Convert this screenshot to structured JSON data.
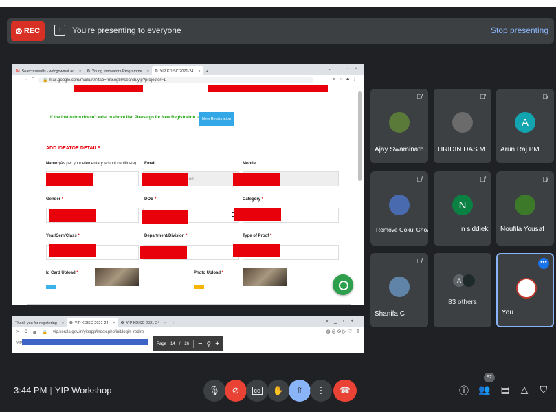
{
  "topbar": {
    "rec_label": "REC",
    "presenting_text": "You're presenting to everyone",
    "stop_label": "Stop presenting"
  },
  "browser1": {
    "tabs": [
      {
        "label": "Search results - wdcgowmat.ac"
      },
      {
        "label": "Young Innovators Programme"
      },
      {
        "label": "YIP KDISC 2021-24"
      }
    ],
    "new_tab": "+",
    "url": "mail.google.com/mail/u/0/?tab=rm&ogbl#search/yip?projector=1",
    "reg_note": "If the Institution doesn't exist in above list, Please go for New Registration -->",
    "reg_button": "New Registration",
    "section_title": "ADD IDEATOR DETAILS",
    "fields": {
      "name_label": "Name",
      "name_hint": "(As per your elementary school certificate)",
      "email_label": "Email",
      "email_tail": "om",
      "mobile_label": "Mobile",
      "gender_label": "Gender",
      "dob_label": "DOB",
      "category_label": "Category",
      "year_label": "Year/Sem/Class",
      "department_label": "Department/Division",
      "proof_label": "Type of Proof",
      "idcard_label": "Id Card Upload",
      "photo_label": "Photo Upload"
    }
  },
  "browser2": {
    "tabs": [
      {
        "label": "Thank you for registering"
      },
      {
        "label": "YIP KDISC 2021-24"
      },
      {
        "label": "YIP KDISC 2021-24"
      }
    ],
    "url": "yip.kerala.gov.in/yipapp/index.php/init/login_redire",
    "page_label": "Page",
    "page_current": "14",
    "page_sep": "/",
    "page_total": "26",
    "zoom_out": "−",
    "zoom_in": "+",
    "yip_prefix": "YIP K"
  },
  "participants": [
    {
      "name": "Ajay Swaminath...",
      "avatar_color": "#5a7a3a"
    },
    {
      "name": "HRIDIN DAS M",
      "avatar_color": "#6b6b6b"
    },
    {
      "name": "Arun Raj PM",
      "letter": "A",
      "avatar_color": "#12a4af"
    },
    {
      "name": "Remove Gokul Chowallur from the call",
      "avatar_color": "#4a6ab0"
    },
    {
      "name": "n siddiek",
      "letter": "N",
      "avatar_color": "#0b8043"
    },
    {
      "name": "Noufila Yousaf",
      "avatar_color": "#3c7a2a"
    },
    {
      "name": "Shanifa C",
      "avatar_color": "#5f84a8"
    },
    {
      "name": "83 others",
      "letter": "A",
      "avatar_color": "#5f6368"
    },
    {
      "name": "You",
      "avatar_color": "#ffffff"
    }
  ],
  "bottom": {
    "time": "3:44 PM",
    "divider": "|",
    "meeting_name": "YIP Workshop",
    "people_count": "92"
  },
  "colors": {
    "background": "#202124",
    "tile": "#3c4043",
    "accent_red": "#ea4335",
    "accent_blue": "#8ab4f8"
  }
}
